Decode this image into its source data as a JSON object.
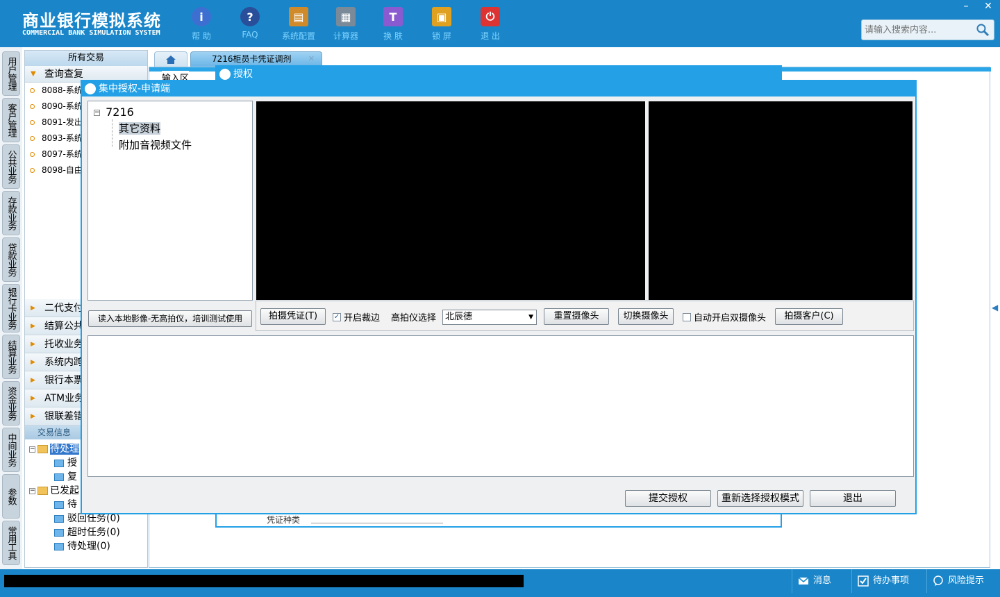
{
  "app": {
    "title_cn": "商业银行模拟系统",
    "title_en": "COMMERCIAL BANK SIMULATION SYSTEM"
  },
  "toolbar": [
    {
      "label": "帮 助",
      "icon": "info-icon",
      "color": "#3d6fd1",
      "glyph": "i"
    },
    {
      "label": "FAQ",
      "icon": "question-icon",
      "color": "#2a4f9a",
      "glyph": "?"
    },
    {
      "label": "系统配置",
      "icon": "toolbox-icon",
      "color": "#d08a2a",
      "glyph": "▤"
    },
    {
      "label": "计算器",
      "icon": "calculator-icon",
      "color": "#7a8a98",
      "glyph": "▦"
    },
    {
      "label": "换 肤",
      "icon": "shirt-icon",
      "color": "#8a5bd0",
      "glyph": "👕"
    },
    {
      "label": "锁 屏",
      "icon": "lock-icon",
      "color": "#e0a020",
      "glyph": "🔒"
    },
    {
      "label": "退 出",
      "icon": "power-icon",
      "color": "#d33",
      "glyph": "⏻"
    }
  ],
  "search": {
    "placeholder": "请输入搜索内容..."
  },
  "window_controls": {
    "minimize": "–",
    "close": "✕"
  },
  "vertical_tabs": [
    "用户管理",
    "客户管理",
    "公共业务",
    "存款业务",
    "贷款业务",
    "银行卡业务",
    "结算业务",
    "资金业务",
    "中间业务",
    "参数",
    "常用工具"
  ],
  "left_panel": {
    "header": "所有交易",
    "query_group": "查询查复",
    "query_items": [
      "8088-系统",
      "8090-系统",
      "8091-发出",
      "8093-系统",
      "8097-系统",
      "8098-自由"
    ],
    "groups": [
      "二代支付",
      "结算公共",
      "托收业务",
      "系统内跨",
      "银行本票",
      "ATM业务",
      "银联差错"
    ],
    "trans_header": "交易信息",
    "tree": {
      "pending_folder": "待处理",
      "pending_children": [
        "授",
        "复"
      ],
      "sent_folder": "已发起",
      "sent_children": [
        "待",
        "驳回任务(0)",
        "超时任务(0)",
        "待处理(0)"
      ]
    }
  },
  "tabs": {
    "active": "7216柜员卡凭证调剂",
    "close": "✕"
  },
  "background_dialog": {
    "title": "授权",
    "input_area": "输入区",
    "voucher_label": "凭证种类"
  },
  "modal": {
    "title": "集中授权-申请端",
    "tree": {
      "root": "7216",
      "children": [
        "其它资料",
        "附加音视频文件"
      ]
    },
    "load_local_button": "读入本地影像-无高拍仪，培训测试使用",
    "controls": {
      "capture_voucher": "拍摄凭证(T)",
      "auto_crop_label": "开启裁边",
      "auto_crop_checked": true,
      "scanner_label": "高拍仪选择",
      "scanner_value": "北辰德",
      "reset_camera": "重置摄像头",
      "switch_camera": "切换摄像头",
      "auto_dual_label": "自动开启双摄像头",
      "auto_dual_checked": false,
      "capture_customer": "拍摄客户(C)"
    },
    "footer": {
      "submit": "提交授权",
      "reselect": "重新选择授权模式",
      "exit": "退出"
    }
  },
  "statusbar": {
    "message": "消息",
    "todo": "待办事项",
    "risk": "风险提示"
  },
  "colors": {
    "primary": "#1a86c9",
    "dialog_title": "#23a0e6",
    "toolbar_label": "#7fd3ff"
  }
}
